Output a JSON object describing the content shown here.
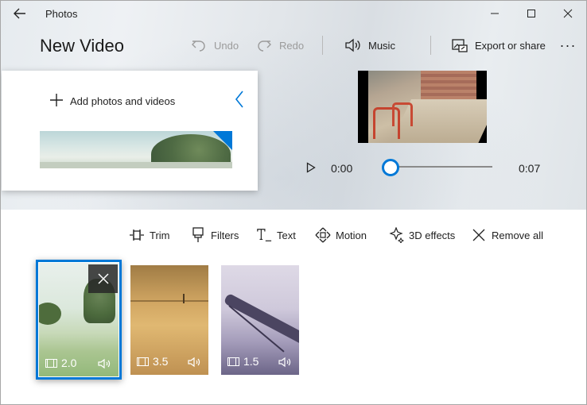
{
  "window": {
    "app_title": "Photos"
  },
  "header": {
    "page_title": "New Video",
    "undo_label": "Undo",
    "redo_label": "Redo",
    "music_label": "Music",
    "export_label": "Export or share",
    "more_label": "···"
  },
  "library": {
    "add_label": "Add photos and videos"
  },
  "player": {
    "current_time": "0:00",
    "end_time": "0:07",
    "progress": 0.0
  },
  "storyboard_tools": {
    "trim": "Trim",
    "filters": "Filters",
    "text": "Text",
    "motion": "Motion",
    "effects_3d": "3D effects",
    "remove_all": "Remove all"
  },
  "clips": [
    {
      "duration": "2.0",
      "selected": true
    },
    {
      "duration": "3.5",
      "selected": false
    },
    {
      "duration": "1.5",
      "selected": false
    }
  ],
  "colors": {
    "accent": "#0078d7"
  },
  "icons": {
    "back": "back-arrow-icon",
    "undo": "undo-icon",
    "redo": "redo-icon",
    "music": "speaker-icon",
    "export": "export-icon",
    "play": "play-icon"
  }
}
